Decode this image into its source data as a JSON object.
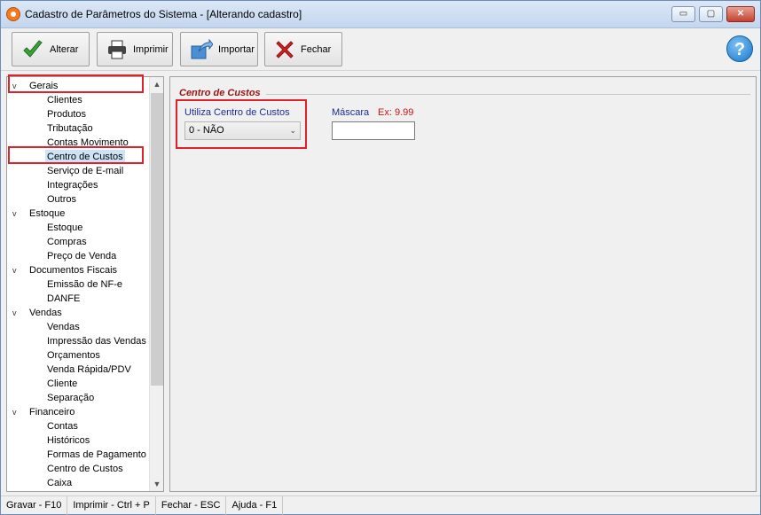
{
  "window": {
    "title": "Cadastro de Parâmetros do Sistema - [Alterando cadastro]",
    "controls": {
      "minimize": "▭",
      "maximize": "▢",
      "close": "✕"
    }
  },
  "toolbar": {
    "alterar_label": "Alterar",
    "imprimir_label": "Imprimir",
    "importar_label": "Importar",
    "fechar_label": "Fechar",
    "help_label": "?"
  },
  "tree": {
    "groups": [
      {
        "label": "Gerais",
        "items": [
          "Clientes",
          "Produtos",
          "Tributação",
          "Contas Movimento",
          "Centro de Custos",
          "Serviço de E-mail",
          "Integrações",
          "Outros"
        ]
      },
      {
        "label": "Estoque",
        "items": [
          "Estoque",
          "Compras",
          "Preço de Venda"
        ]
      },
      {
        "label": "Documentos Fiscais",
        "items": [
          "Emissão de NF-e",
          "DANFE"
        ]
      },
      {
        "label": "Vendas",
        "items": [
          "Vendas",
          "Impressão das Vendas",
          "Orçamentos",
          "Venda Rápida/PDV",
          "Cliente",
          "Separação"
        ]
      },
      {
        "label": "Financeiro",
        "items": [
          "Contas",
          "Históricos",
          "Formas de Pagamento",
          "Centro de Custos",
          "Caixa"
        ]
      }
    ],
    "selected": "Centro de Custos",
    "chevron": "v"
  },
  "panel": {
    "group_title": "Centro de Custos",
    "utiliza_label": "Utiliza Centro de Custos",
    "utiliza_value": "0 - NÃO",
    "mascara_label": "Máscara",
    "mascara_example": "Ex: 9.99",
    "mascara_value": ""
  },
  "statusbar": {
    "items": [
      "Gravar - F10",
      "Imprimir - Ctrl + P",
      "Fechar - ESC",
      "Ajuda - F1"
    ]
  },
  "colors": {
    "highlight_box": "#e0202a",
    "group_title": "#9b1414",
    "label_blue": "#1b2d8f",
    "example_red": "#c81414",
    "selection": "#cce4f7"
  }
}
